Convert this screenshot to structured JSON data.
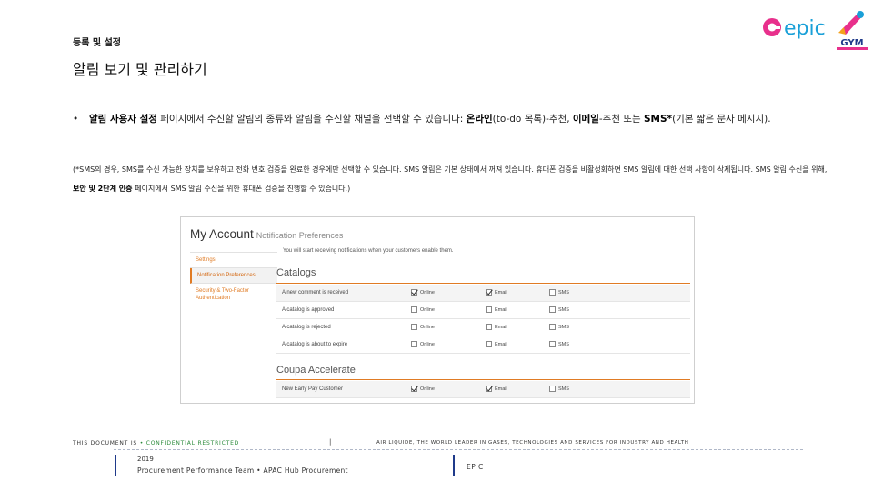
{
  "header": {
    "breadcrumb": "등록 및 설정",
    "title": "알림 보기 및 관리하기"
  },
  "logos": {
    "epic_text": "epic",
    "gym_text": "GYM"
  },
  "body": {
    "bullet_dot": "•",
    "p1_b1": "알림 사용자 설정",
    "p1_t1": " 페이지에서 수신할 알림의 종류와 알림을 수신할 채널을 선택할 수 있습니다: ",
    "p1_b2": "온라인",
    "p1_t2": "(to-do 목록)-추천, ",
    "p1_b3": "이메일",
    "p1_t3": "-추천 또는 ",
    "p1_b4": "SMS*",
    "p1_t4": "(기본 짧은 문자 메시지).",
    "note_t1": "(*SMS의 경우, SMS를 수신 가능한 장치를 보유하고 전화 번호 검증을 완료한 경우에만 선택할 수 있습니다. SMS 알림은 기본 상태에서 꺼져 있습니다. 휴대폰 검증을 비활성화하면 SMS 알림에 대한 선택 사항이 삭제됩니다. SMS 알림 수신을 위해, ",
    "note_b1": "보안 및 2단계 인증 ",
    "note_t2": "페이지에서 SMS 알림 수신을 위한 휴대폰 검증을 진행할 수 있습니다.)"
  },
  "screenshot": {
    "heading": "My Account",
    "subheading": "Notification Preferences",
    "subtitle": "You will start receiving notifications when your customers enable them.",
    "sidebar": [
      {
        "label": "Settings",
        "active": false
      },
      {
        "label": "Notification Preferences",
        "active": true
      },
      {
        "label": "Security & Two-Factor Authentication",
        "active": false
      }
    ],
    "sections": [
      {
        "title": "Catalogs",
        "rows": [
          {
            "label": "A new comment is received",
            "online": true,
            "email": true,
            "sms": false
          },
          {
            "label": "A catalog is approved",
            "online": false,
            "email": false,
            "sms": false
          },
          {
            "label": "A catalog is rejected",
            "online": false,
            "email": false,
            "sms": false
          },
          {
            "label": "A catalog is about to expire",
            "online": false,
            "email": false,
            "sms": false
          }
        ]
      },
      {
        "title": "Coupa Accelerate",
        "rows": [
          {
            "label": "New Early Pay Customer",
            "online": true,
            "email": true,
            "sms": false
          }
        ]
      }
    ],
    "options": {
      "online": "Online",
      "email": "Email",
      "sms": "SMS"
    }
  },
  "footer": {
    "doc_label": "THIS DOCUMENT IS ",
    "confidential": "• CONFIDENTIAL RESTRICTED",
    "separator": "|",
    "company_line": "AIR LIQUIDE, THE WORLD LEADER IN GASES, TECHNOLOGIES AND SERVICES FOR INDUSTRY AND HEALTH",
    "year": "2019",
    "team": "Procurement Performance Team • APAC Hub Procurement",
    "brand": "EPIC"
  },
  "colors": {
    "accent_orange": "#e07b24",
    "footer_blue": "#1f3a8a",
    "confidential_green": "#2a8a3a"
  }
}
